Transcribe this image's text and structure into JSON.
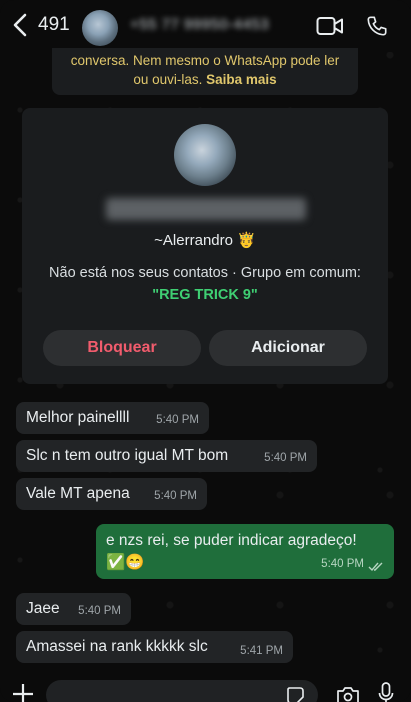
{
  "header": {
    "back_count": "491",
    "contact_phone_blurred": "+55 77 99950-4453"
  },
  "notice": {
    "text": "conversa. Nem mesmo o WhatsApp pode ler\nou ouvi-las.",
    "link": "Saiba mais"
  },
  "card": {
    "phone_blurred": "+55 77 99950-4453",
    "name": "~Alerrandro 🤴",
    "info_line": "Não está nos seus contatos · Grupo em comum:",
    "group_name": "\"REG TRICK 9\"",
    "block_label": "Bloquear",
    "add_label": "Adicionar"
  },
  "messages": [
    {
      "direction": "in",
      "text": "Melhor painellll",
      "time": "5:40 PM"
    },
    {
      "direction": "in",
      "text": "Slc n tem outro igual MT bom",
      "time": "5:40 PM"
    },
    {
      "direction": "in",
      "text": "Vale MT apena",
      "time": "5:40 PM"
    },
    {
      "direction": "out",
      "text": "e nzs rei, se puder indicar agradeço!",
      "text2": "✅😁",
      "time": "5:40 PM"
    },
    {
      "direction": "in",
      "text": "Jaee",
      "time": "5:40 PM"
    },
    {
      "direction": "in",
      "text": "Amassei na rank kkkkk slc",
      "time": "5:41 PM"
    }
  ],
  "colors": {
    "accent_green": "#3fcf73",
    "block_red": "#f15c6d",
    "notice_yellow": "#e0c76c",
    "outgoing_bubble": "#1f6e3b"
  }
}
